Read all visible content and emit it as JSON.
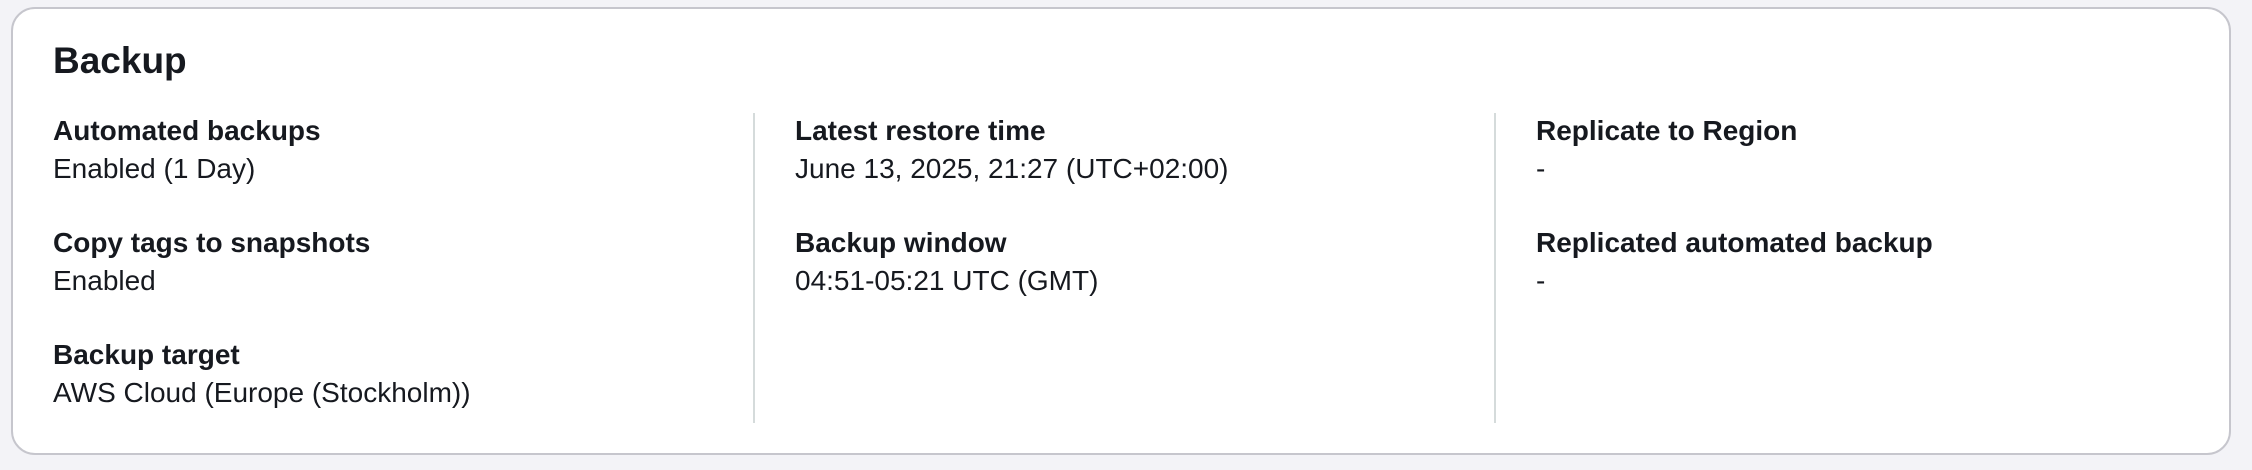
{
  "section": {
    "title": "Backup"
  },
  "columns": [
    {
      "items": [
        {
          "label": "Automated backups",
          "value": "Enabled (1 Day)"
        },
        {
          "label": "Copy tags to snapshots",
          "value": "Enabled"
        },
        {
          "label": "Backup target",
          "value": "AWS Cloud (Europe (Stockholm))"
        }
      ]
    },
    {
      "items": [
        {
          "label": "Latest restore time",
          "value": "June 13, 2025, 21:27 (UTC+02:00)"
        },
        {
          "label": "Backup window",
          "value": "04:51-05:21 UTC (GMT)"
        }
      ]
    },
    {
      "items": [
        {
          "label": "Replicate to Region",
          "value": "-"
        },
        {
          "label": "Replicated automated backup",
          "value": "-"
        }
      ]
    }
  ]
}
